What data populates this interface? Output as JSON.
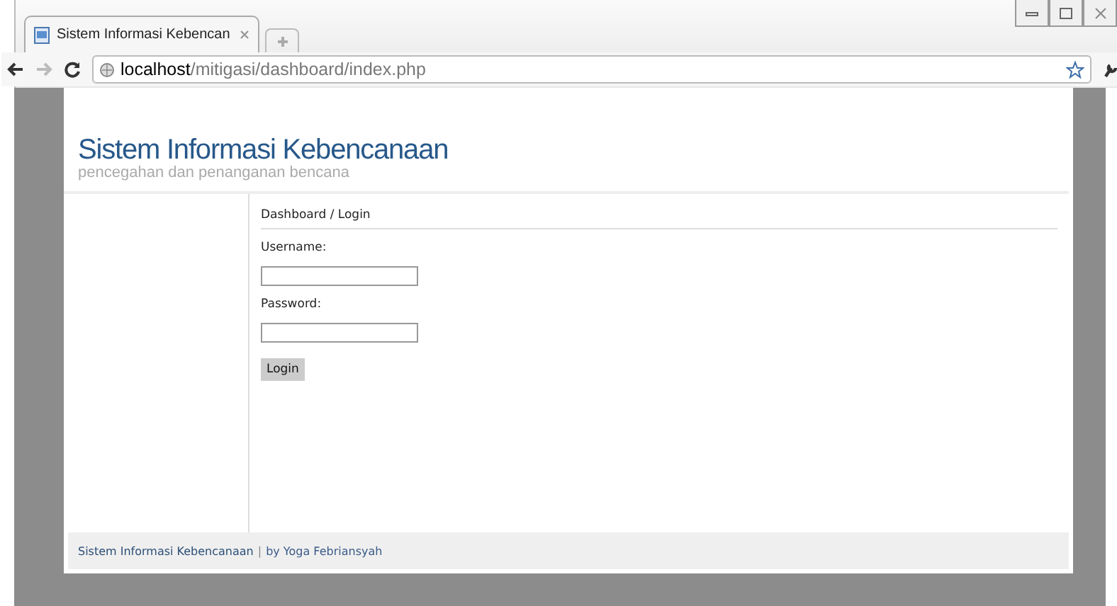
{
  "browser": {
    "tab_title": "Sistem Informasi Kebencan",
    "url_host": "localhost",
    "url_path": "/mitigasi/dashboard/index.php"
  },
  "header": {
    "title": "Sistem Informasi Kebencanaan",
    "subtitle": "pencegahan dan penanganan bencana"
  },
  "breadcrumb": "Dashboard / Login",
  "form": {
    "fields": [
      {
        "label": "Username:"
      },
      {
        "label": "Password:"
      }
    ],
    "submit": "Login"
  },
  "footer": {
    "site": "Sistem Informasi Kebencanaan",
    "separator": "|",
    "credit": "by Yoga Febriansyah"
  }
}
